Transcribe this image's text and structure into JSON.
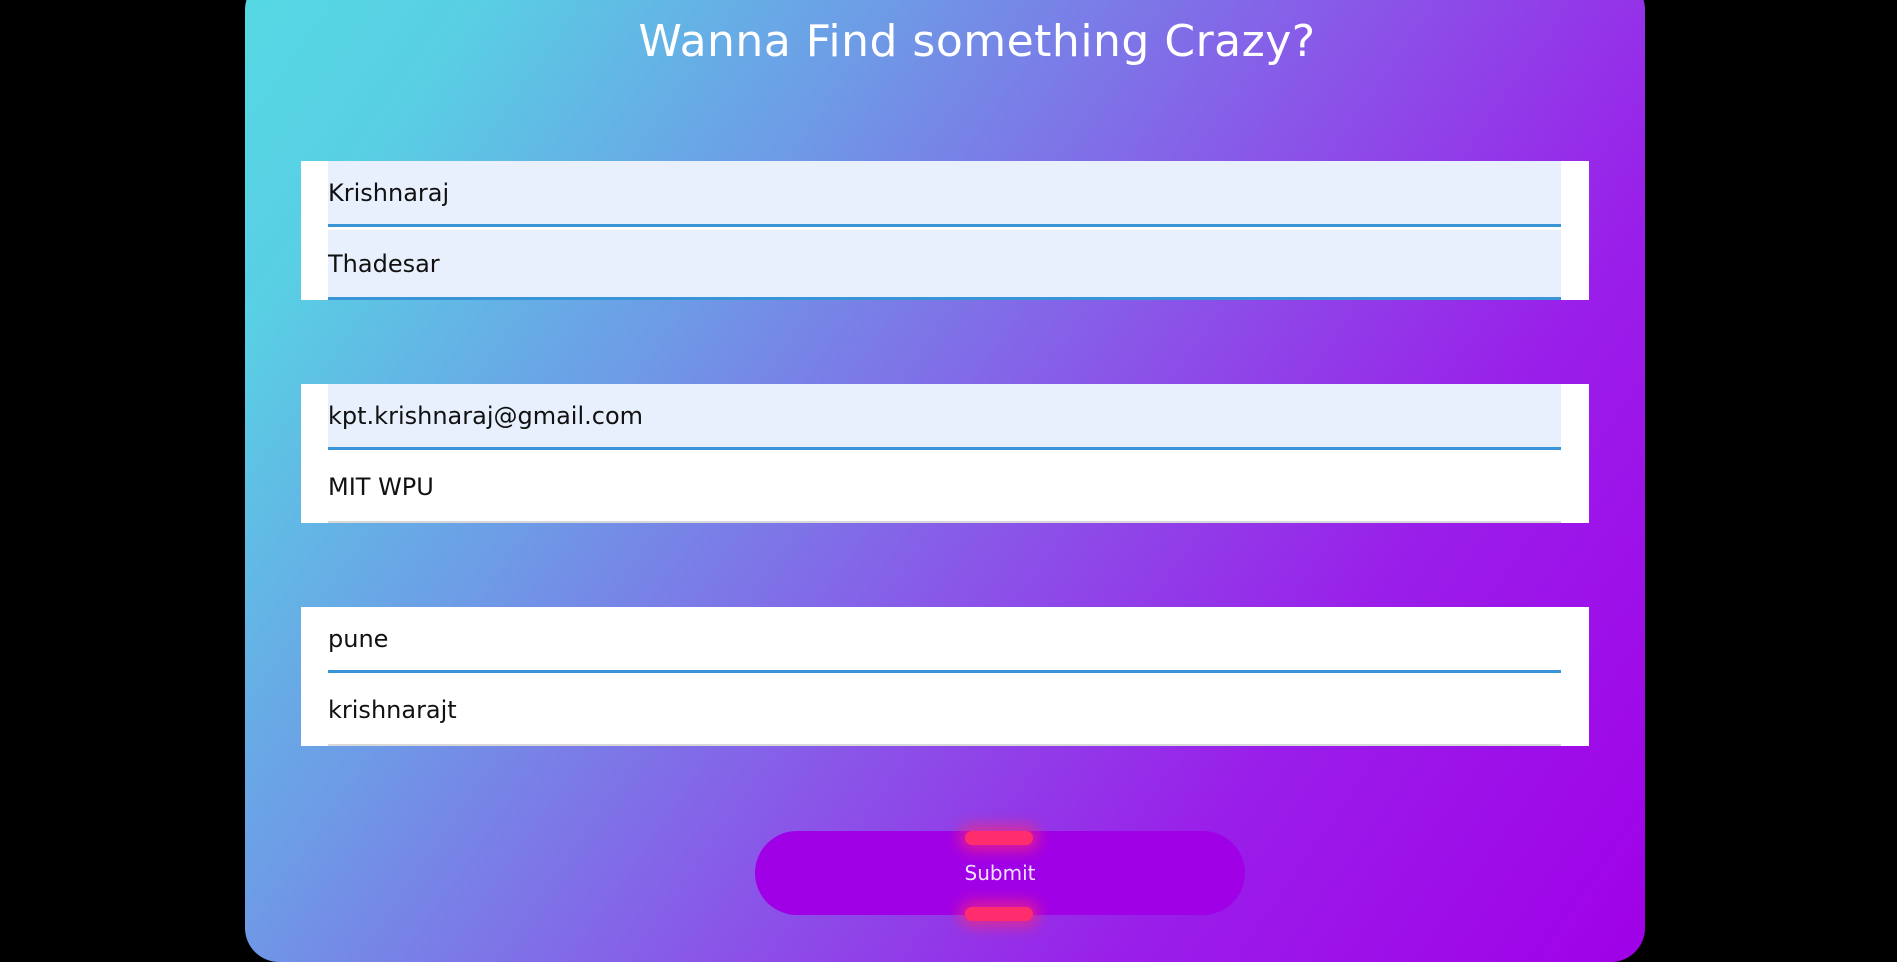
{
  "header": {
    "title": "Wanna Find something Crazy?"
  },
  "form": {
    "first_name": "Krishnaraj",
    "last_name": "Thadesar",
    "email": "kpt.krishnaraj@gmail.com",
    "college": "MIT WPU",
    "city": "pune",
    "username": "krishnarajt",
    "submit_label": "Submit"
  },
  "colors": {
    "gradient_start": "#55d9e3",
    "gradient_end": "#a000e8",
    "button": "#a000e6",
    "glow": "#ff2d6e",
    "field_underline": "#3a94d8"
  }
}
